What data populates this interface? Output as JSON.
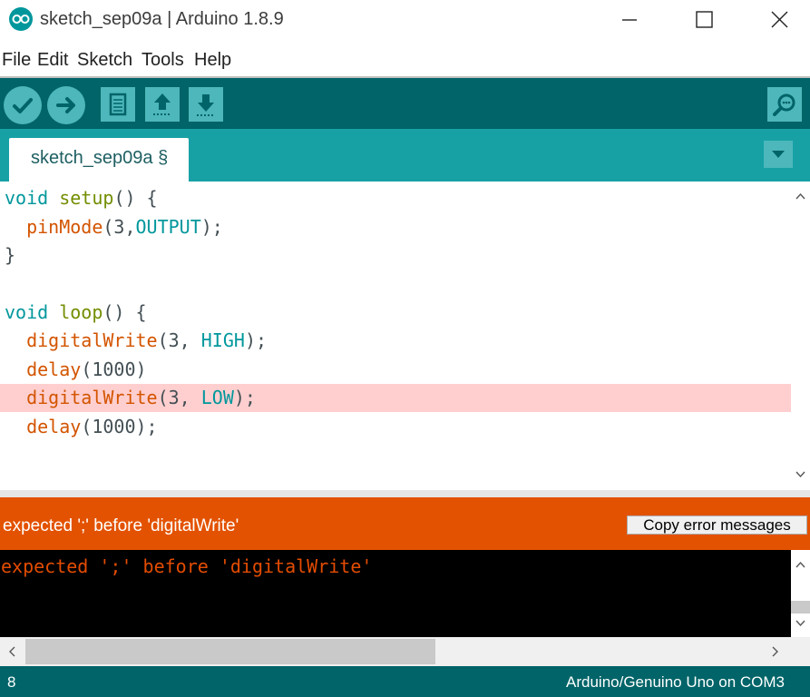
{
  "window": {
    "title": "sketch_sep09a | Arduino 1.8.9"
  },
  "menu": [
    "File",
    "Edit",
    "Sketch",
    "Tools",
    "Help"
  ],
  "toolbar": {
    "icons": [
      "verify-icon",
      "upload-icon",
      "new-icon",
      "open-icon",
      "save-icon",
      "serial-monitor-icon"
    ]
  },
  "tab": {
    "label": "sketch_sep09a §"
  },
  "code": [
    [
      {
        "t": "void",
        "c": "kw"
      },
      {
        "t": " ",
        "c": "plain"
      },
      {
        "t": "setup",
        "c": "fn2"
      },
      {
        "t": "() {",
        "c": "plain"
      }
    ],
    [
      {
        "t": "  ",
        "c": "plain"
      },
      {
        "t": "pinMode",
        "c": "fn"
      },
      {
        "t": "(3,",
        "c": "plain"
      },
      {
        "t": "OUTPUT",
        "c": "const"
      },
      {
        "t": ");",
        "c": "plain"
      }
    ],
    [
      {
        "t": "}",
        "c": "plain"
      }
    ],
    [],
    [
      {
        "t": "void",
        "c": "kw"
      },
      {
        "t": " ",
        "c": "plain"
      },
      {
        "t": "loop",
        "c": "fn2"
      },
      {
        "t": "() {",
        "c": "plain"
      }
    ],
    [
      {
        "t": "  ",
        "c": "plain"
      },
      {
        "t": "digitalWrite",
        "c": "fn"
      },
      {
        "t": "(3, ",
        "c": "plain"
      },
      {
        "t": "HIGH",
        "c": "const"
      },
      {
        "t": ");",
        "c": "plain"
      }
    ],
    [
      {
        "t": "  ",
        "c": "plain"
      },
      {
        "t": "delay",
        "c": "fn"
      },
      {
        "t": "(1000)",
        "c": "plain"
      }
    ],
    [
      {
        "t": "  ",
        "c": "plain"
      },
      {
        "t": "digitalWrite",
        "c": "fn"
      },
      {
        "t": "(3, ",
        "c": "plain"
      },
      {
        "t": "LOW",
        "c": "const"
      },
      {
        "t": ");",
        "c": "plain"
      }
    ],
    [
      {
        "t": "  ",
        "c": "plain"
      },
      {
        "t": "delay",
        "c": "fn"
      },
      {
        "t": "(1000);",
        "c": "plain"
      }
    ]
  ],
  "error_line_index": 7,
  "error_bar": {
    "message": "expected ';' before 'digitalWrite'",
    "copy_button": "Copy error messages"
  },
  "console": {
    "text": "expected ';' before 'digitalWrite'"
  },
  "status": {
    "line_number": "8",
    "board": "Arduino/Genuino Uno on COM3"
  },
  "colors": {
    "teal_dark": "#006468",
    "teal": "#17a1a5",
    "error_orange": "#e35200",
    "error_highlight": "#ffcfcf"
  }
}
